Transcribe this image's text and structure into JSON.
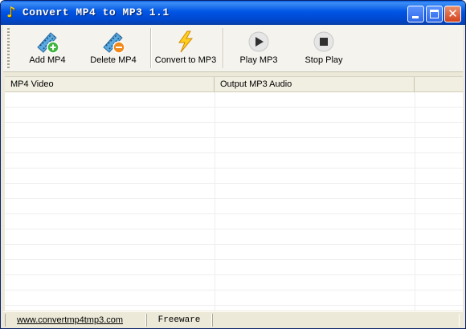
{
  "window": {
    "title": "Convert MP4 to MP3 1.1",
    "title_icon": "music-note-icon"
  },
  "toolbar": {
    "items": [
      {
        "label": "Add MP4",
        "icon": "film-add-icon"
      },
      {
        "label": "Delete MP4",
        "icon": "film-delete-icon"
      },
      {
        "label": "Convert to MP3",
        "icon": "lightning-icon"
      },
      {
        "label": "Play MP3",
        "icon": "play-icon"
      },
      {
        "label": "Stop Play",
        "icon": "stop-icon"
      }
    ]
  },
  "list": {
    "columns": [
      "MP4 Video",
      "Output MP3 Audio",
      ""
    ],
    "rows": []
  },
  "status": {
    "link": "www.convertmp4tmp3.com",
    "license": "Freeware"
  },
  "colors": {
    "titlebar": "#0055e5",
    "window_bg": "#ece9d8",
    "accent_yellow": "#ffd200"
  }
}
